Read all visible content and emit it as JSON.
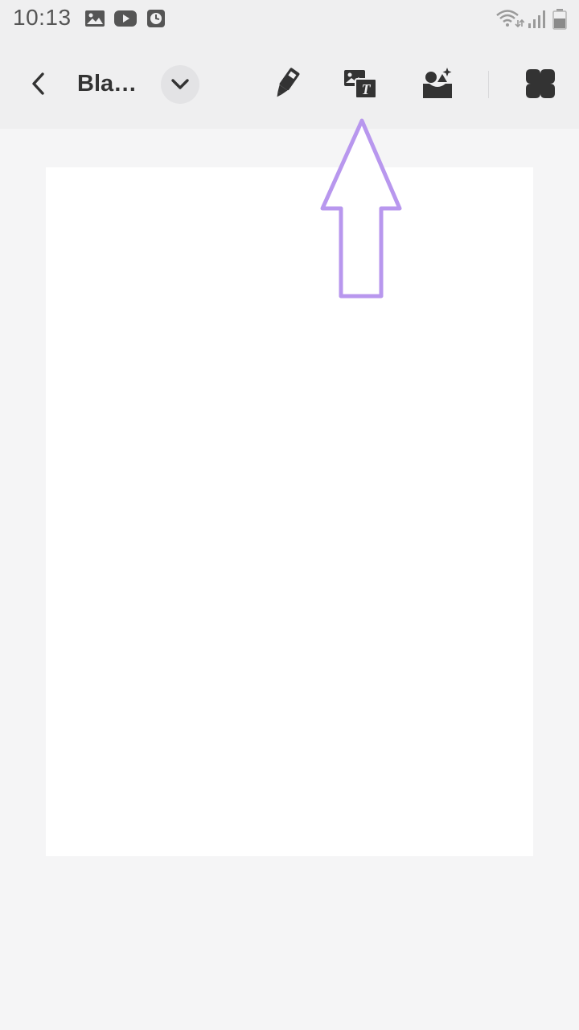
{
  "status_bar": {
    "time": "10:13",
    "left_icons": [
      "gallery-notification-icon",
      "youtube-notification-icon",
      "clock-notification-icon"
    ],
    "right_icons": [
      "wifi-icon",
      "signal-icon",
      "battery-icon"
    ]
  },
  "toolbar": {
    "title": "Bla…",
    "back_icon": "chevron-left-icon",
    "dropdown_icon": "chevron-down-icon",
    "actions": [
      "pen-icon",
      "image-text-icon",
      "sticker-icon",
      "more-icon"
    ]
  },
  "overlay": {
    "arrow_color": "#b897ee",
    "arrow_icon": "up-arrow-icon"
  },
  "colors": {
    "toolbar_bg": "#efeff0",
    "canvas_bg": "#f5f5f6",
    "page_bg": "#ffffff",
    "icon_dark": "#333333"
  }
}
